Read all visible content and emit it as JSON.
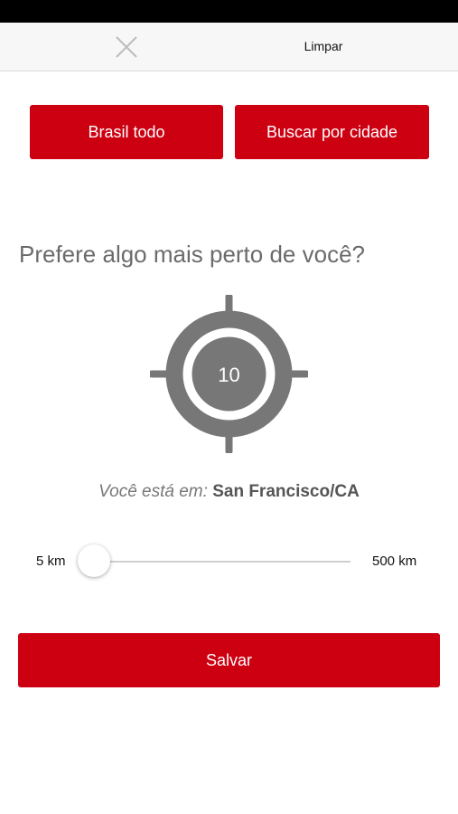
{
  "top_bar": {
    "close_icon": "close-icon",
    "clear_label": "Limpar"
  },
  "buttons": {
    "brasil_label": "Brasil todo",
    "cidade_label": "Buscar por cidade",
    "save_label": "Salvar"
  },
  "question": "Prefere algo mais perto de você?",
  "target": {
    "icon": "crosshair-icon",
    "value": "10"
  },
  "location": {
    "label": "Você está em:",
    "value": "San Francisco/CA"
  },
  "slider": {
    "min_label": "5 km",
    "max_label": "500 km",
    "min": 5,
    "max": 500,
    "value": 5
  },
  "colors": {
    "accent": "#cc0011",
    "target_gray": "#777777",
    "status_bar": "#000000"
  }
}
